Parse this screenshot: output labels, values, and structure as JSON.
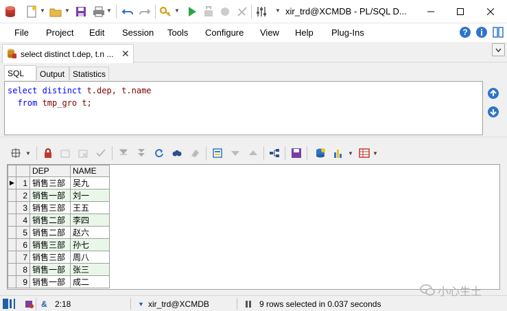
{
  "titlebar": {
    "title": "xir_trd@XCMDB - PL/SQL D...",
    "icons": [
      "database-icon",
      "new-icon",
      "open-icon",
      "save-icon",
      "print-icon",
      "undo-icon",
      "redo-icon",
      "key-icon",
      "execute-icon",
      "break-icon",
      "commit-icon",
      "rollback-icon",
      "settings-icon"
    ]
  },
  "menu": {
    "items": [
      "File",
      "Project",
      "Edit",
      "Session",
      "Tools",
      "Configure",
      "View",
      "Help",
      "Plug-Ins"
    ]
  },
  "doctab": {
    "label": "select distinct t.dep, t.n ...",
    "close": "✕"
  },
  "subtabs": [
    "SQL",
    "Output",
    "Statistics"
  ],
  "editor": {
    "line1": {
      "kw1": "select distinct ",
      "rest": "t.dep, t.name"
    },
    "line2": {
      "indent": "  ",
      "kw1": "from ",
      "rest": "tmp_gro t;"
    }
  },
  "grid": {
    "columns": [
      "DEP",
      "NAME"
    ],
    "rows": [
      {
        "n": "1",
        "dep": "销售三部",
        "name": "吴九"
      },
      {
        "n": "2",
        "dep": "销售一部",
        "name": "刘一"
      },
      {
        "n": "3",
        "dep": "销售三部",
        "name": "王五"
      },
      {
        "n": "4",
        "dep": "销售二部",
        "name": "李四"
      },
      {
        "n": "5",
        "dep": "销售二部",
        "name": "赵六"
      },
      {
        "n": "6",
        "dep": "销售三部",
        "name": "孙七"
      },
      {
        "n": "7",
        "dep": "销售三部",
        "name": "周八"
      },
      {
        "n": "8",
        "dep": "销售一部",
        "name": "张三"
      },
      {
        "n": "9",
        "dep": "销售一部",
        "name": "成二"
      }
    ],
    "current_row_marker": "▶"
  },
  "statusbar": {
    "position": "2:18",
    "connection": "xir_trd@XCMDB",
    "message": "9 rows selected in 0.037 seconds"
  },
  "watermark": {
    "text": "小心生土"
  },
  "colors": {
    "keyword": "#0000ff",
    "identifier": "#800000",
    "alt_row": "#e9f7e9"
  }
}
